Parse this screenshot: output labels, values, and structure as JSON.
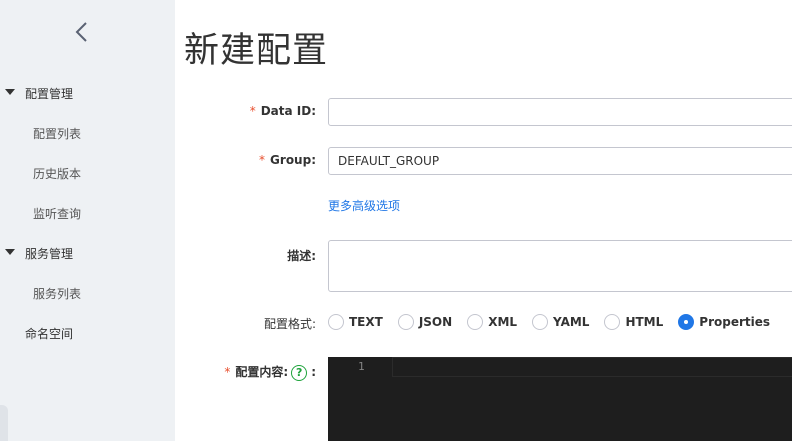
{
  "sidebar": {
    "collapse_icon": "chevron-left-icon",
    "groups": [
      {
        "label": "配置管理",
        "items": [
          "配置列表",
          "历史版本",
          "监听查询"
        ]
      },
      {
        "label": "服务管理",
        "items": [
          "服务列表"
        ]
      }
    ],
    "top_item": "命名空间"
  },
  "page": {
    "title": "新建配置"
  },
  "form": {
    "required_mark": "*",
    "data_id": {
      "label": "Data ID:",
      "value": "",
      "placeholder": ""
    },
    "group": {
      "label": "Group:",
      "value": "DEFAULT_GROUP"
    },
    "advanced_link": "更多高级选项",
    "description": {
      "label": "描述:",
      "value": ""
    },
    "format": {
      "label": "配置格式:",
      "options": [
        "TEXT",
        "JSON",
        "XML",
        "YAML",
        "HTML",
        "Properties"
      ],
      "selected": "Properties"
    },
    "content": {
      "label": "配置内容:",
      "help_glyph": "?",
      "suffix": ":",
      "line_number": "1"
    }
  },
  "colors": {
    "accent": "#2077e6",
    "required": "#e84e2d",
    "help": "#1fa33c",
    "editor_bg": "#1e1e1e",
    "sidebar_bg": "#eef1f4"
  }
}
